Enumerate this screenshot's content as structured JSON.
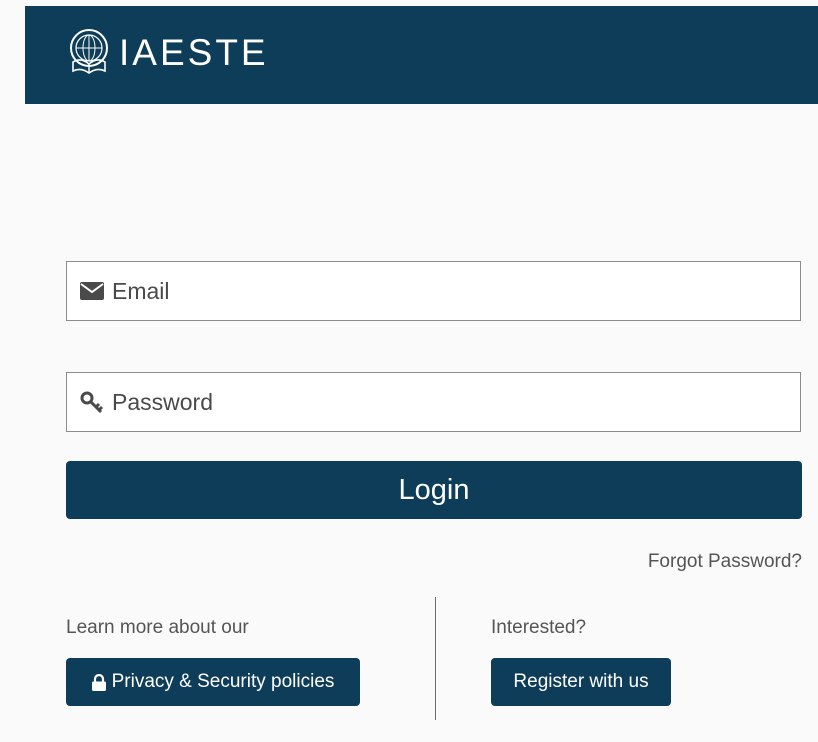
{
  "header": {
    "brand": "IAESTE",
    "colors": {
      "background": "#0d3d58"
    }
  },
  "login_form": {
    "email": {
      "placeholder": "Email",
      "value": "",
      "icon": "envelope-icon"
    },
    "password": {
      "placeholder": "Password",
      "value": "",
      "icon": "key-icon"
    },
    "login_label": "Login",
    "forgot_label": "Forgot Password?"
  },
  "footer": {
    "privacy": {
      "caption": "Learn more about our",
      "button_label": "Privacy & Security policies",
      "icon": "lock-icon"
    },
    "register": {
      "caption": "Interested?",
      "button_label": "Register with us"
    }
  },
  "colors": {
    "primary": "#0d3d58",
    "background": "#fafafa",
    "muted_text": "#555555"
  }
}
